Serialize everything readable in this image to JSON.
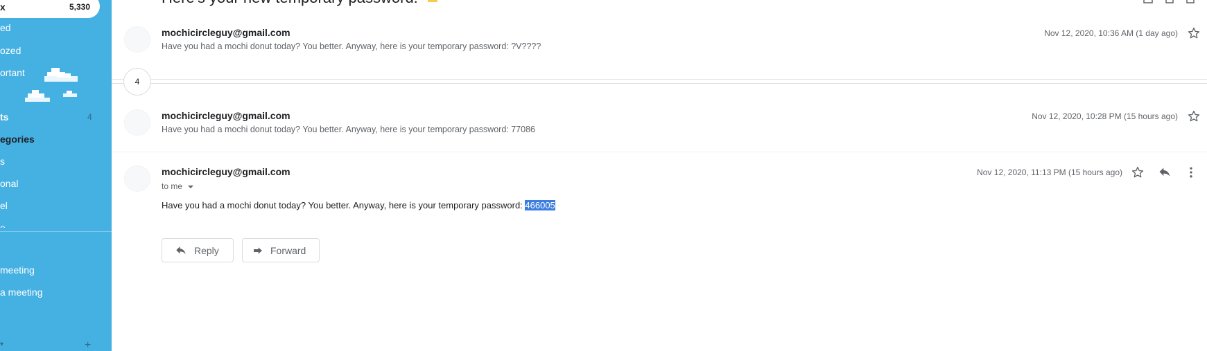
{
  "sidebar": {
    "inbox_label": "x",
    "inbox_count": "5,330",
    "items": [
      {
        "label": "ed"
      },
      {
        "label": "ozed"
      },
      {
        "label": "ortant"
      },
      {
        "label": "ts",
        "count": "4"
      },
      {
        "label": "egories"
      },
      {
        "label": "s"
      },
      {
        "label": "onal"
      },
      {
        "label": "el"
      },
      {
        "label": "e"
      }
    ],
    "meet": [
      {
        "label": "meeting"
      },
      {
        "label": "a meeting"
      }
    ],
    "add_label": "+"
  },
  "thread": {
    "subject": "Here's your new temporary password.",
    "collapsed_count": "4",
    "messages": [
      {
        "sender": "mochicircleguy@gmail.com",
        "snippet": "Have you had a mochi donut today? You better. Anyway, here is your temporary password: ?V????",
        "date": "Nov 12, 2020, 10:36 AM (1 day ago)"
      },
      {
        "sender": "mochicircleguy@gmail.com",
        "snippet": "Have you had a mochi donut today? You better. Anyway, here is your temporary password: 77086",
        "date": "Nov 12, 2020, 10:28 PM (15 hours ago)"
      },
      {
        "sender": "mochicircleguy@gmail.com",
        "to": "to me",
        "date": "Nov 12, 2020, 11:13 PM (15 hours ago)",
        "body_prefix": "Have you had a mochi donut today? You better. Anyway, here is your temporary password: ",
        "body_selected": "466005"
      }
    ],
    "reply_label": "Reply",
    "forward_label": "Forward"
  },
  "colors": {
    "sidebar_bg": "#45b0e2",
    "selection": "#3b7de0"
  },
  "icons": [
    "star-icon",
    "reply-icon",
    "more-vert-icon",
    "forward-icon",
    "caret-down-icon",
    "cloud-icon"
  ]
}
